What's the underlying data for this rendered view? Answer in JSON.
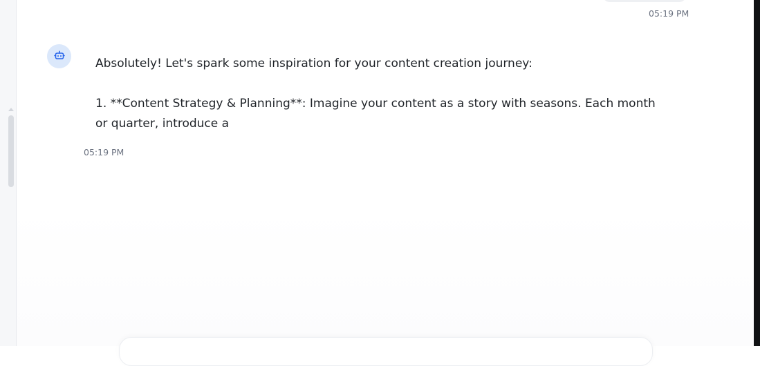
{
  "conversation": {
    "previous_user_message": {
      "time": "05:19 PM"
    },
    "assistant_message": {
      "avatar_icon": "robot-icon",
      "text": "Absolutely! Let's spark some inspiration for your content creation journey:\n\n1. **Content Strategy & Planning**: Imagine your content as a story with seasons. Each month or quarter, introduce a",
      "time": "05:19 PM"
    }
  },
  "colors": {
    "avatar_bg": "#dbe8fb",
    "avatar_icon": "#2563eb",
    "timestamp": "#6b7280",
    "text": "#1f2328"
  }
}
